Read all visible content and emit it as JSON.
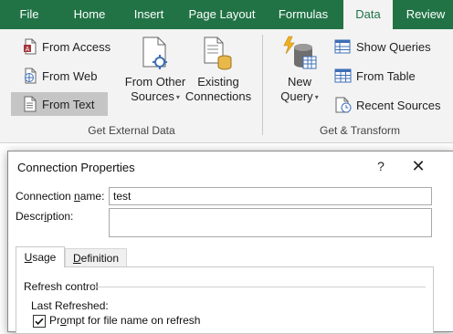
{
  "ribbon_tabs": [
    "File",
    "Home",
    "Insert",
    "Page Layout",
    "Formulas",
    "Data",
    "Review"
  ],
  "active_tab": "Data",
  "get_external_data": {
    "from_access": "From Access",
    "from_web": "From Web",
    "from_text": "From Text",
    "from_other_sources_line1": "From Other",
    "from_other_sources_line2": "Sources",
    "existing_connections_line1": "Existing",
    "existing_connections_line2": "Connections",
    "group_label": "Get External Data"
  },
  "get_transform": {
    "new_query_line1": "New",
    "new_query_line2": "Query",
    "show_queries": "Show Queries",
    "from_table": "From Table",
    "recent_sources": "Recent Sources",
    "group_label": "Get & Transform"
  },
  "colors": {
    "accent": "#217346",
    "ribbon_bg": "#f3f3f3"
  },
  "dialog": {
    "title": "Connection Properties",
    "help_glyph": "?",
    "close_glyph": "✕",
    "connection_name_label_pre": "Connection ",
    "connection_name_label_key": "n",
    "connection_name_label_post": "ame:",
    "connection_name_value": "test",
    "description_label_pre": "Descr",
    "description_label_key": "i",
    "description_label_post": "ption:",
    "description_value": "",
    "tabs": {
      "usage_key": "U",
      "usage_rest": "sage",
      "definition_key": "D",
      "definition_rest": "efinition"
    },
    "refresh_control_label": "Refresh control",
    "last_refreshed_label": "Last Refreshed:",
    "prompt_checkbox_pre": "Pr",
    "prompt_checkbox_key": "o",
    "prompt_checkbox_post": "mpt for file name on refresh",
    "prompt_checked": true
  }
}
